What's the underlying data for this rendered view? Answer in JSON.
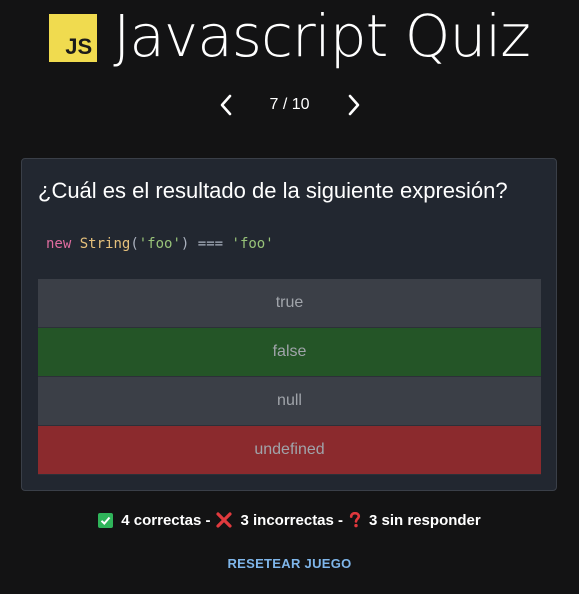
{
  "header": {
    "logo_text": "JS",
    "title": "Javascript Quiz"
  },
  "pager": {
    "current": "7 / 10",
    "prev_icon": "chevron-left-icon",
    "next_icon": "chevron-right-icon"
  },
  "question": {
    "text": "¿Cuál es el resultado de la siguiente expresión?",
    "code": {
      "kw": "new",
      "fn": "String",
      "open": "(",
      "arg": "'foo'",
      "close": ")",
      "op": "===",
      "rhs": "'foo'"
    }
  },
  "answers": [
    {
      "label": "true",
      "state": "neutral"
    },
    {
      "label": "false",
      "state": "correct"
    },
    {
      "label": "null",
      "state": "neutral"
    },
    {
      "label": "undefined",
      "state": "wrong"
    }
  ],
  "score": {
    "correct": "4 correctas -",
    "incorrect": "3 incorrectas -",
    "unanswered": "3 sin responder"
  },
  "reset_label": "RESETEAR JUEGO",
  "colors": {
    "background": "#131314",
    "card": "#222730",
    "correct": "#245527",
    "wrong": "#8b2a2d",
    "neutral": "#3b3f47",
    "link": "#7fb6ea",
    "logo": "#f0db4f"
  }
}
